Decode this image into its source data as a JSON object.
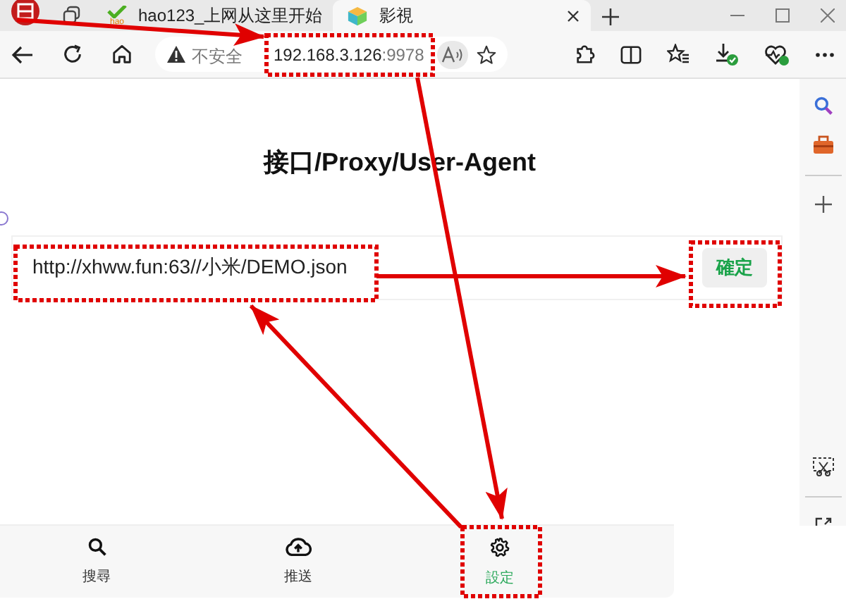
{
  "tabs": [
    {
      "title": "hao123_上网从这里开始",
      "icon_label": "hao",
      "selected": false
    },
    {
      "title": "影視",
      "selected": true
    }
  ],
  "address_bar": {
    "security": "不安全",
    "host": "192.168.3.126",
    "port": ":9978"
  },
  "page": {
    "title": "接口/Proxy/User-Agent",
    "url_value": "http://xhww.fun:63//小米/DEMO.json",
    "confirm": "確定"
  },
  "bottom_nav": [
    {
      "kind": "search",
      "label": "搜尋",
      "selected": false
    },
    {
      "kind": "push",
      "label": "推送",
      "selected": false
    },
    {
      "kind": "settings",
      "label": "設定",
      "selected": true
    }
  ]
}
